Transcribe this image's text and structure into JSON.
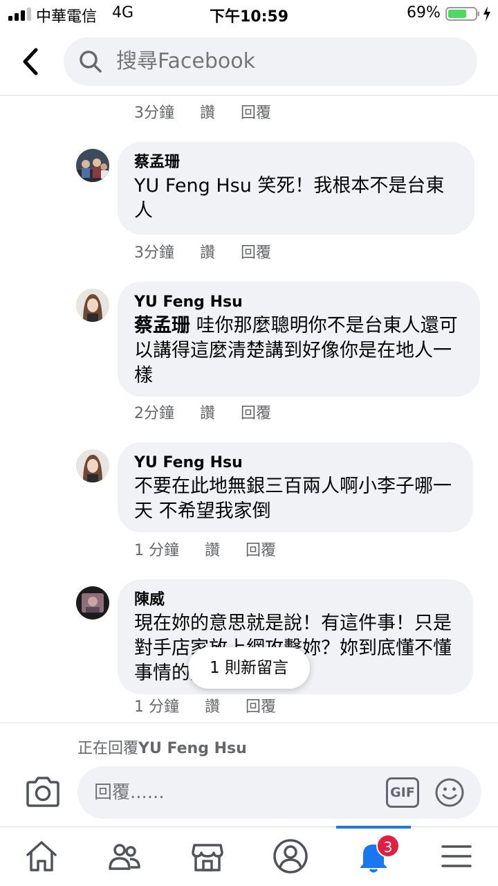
{
  "status_bar": {
    "carrier": "中華電信",
    "network": "4G",
    "time": "下午10:59",
    "battery_percent": "69%",
    "battery_level": 0.69
  },
  "header": {
    "back_icon": "chevron-left-icon",
    "search_placeholder": "搜尋Facebook"
  },
  "comments": {
    "prev_meta": {
      "time": "3分鐘",
      "like": "讚",
      "reply": "回覆"
    },
    "items": [
      {
        "author": "蔡孟珊",
        "text": "YU Feng Hsu 笑死！我根本不是台東人",
        "meta": {
          "time": "3分鐘",
          "like": "讚",
          "reply": "回覆"
        }
      },
      {
        "author": "YU Feng Hsu",
        "tag": "蔡孟珊",
        "text": " 哇你那麼聰明你不是台東人還可以講得這麼清楚講到好像你是在地人一樣",
        "meta": {
          "time": "2分鐘",
          "like": "讚",
          "reply": "回覆"
        }
      },
      {
        "author": "YU Feng Hsu",
        "text": "不要在此地無銀三百兩人啊小李子哪一天 不希望我家倒",
        "meta": {
          "time": "1 分鐘",
          "like": "讚",
          "reply": "回覆"
        }
      },
      {
        "author": "陳威",
        "text": "現在妳的意思就是說！有這件事！只是對手店家放上網攻擊妳？妳到底懂不懂事情的是非對錯？",
        "meta": {
          "time": "1 分鐘",
          "like": "讚",
          "reply": "回覆"
        }
      }
    ],
    "new_comments_pill": "1 則新留言"
  },
  "reply": {
    "replying_prefix": "正在回覆",
    "replying_name": "YU Feng Hsu",
    "placeholder": "回覆......",
    "gif_label": "GIF"
  },
  "bottom_nav": {
    "items": [
      "home-icon",
      "friends-icon",
      "marketplace-icon",
      "profile-icon",
      "notifications-icon",
      "menu-icon"
    ],
    "active": "notifications-icon",
    "notification_badge": "3"
  },
  "colors": {
    "accent": "#1877f2",
    "bubble": "#f0f2f5",
    "muted_text": "#65676b",
    "badge": "#e41e3f",
    "battery": "#4cd964"
  }
}
